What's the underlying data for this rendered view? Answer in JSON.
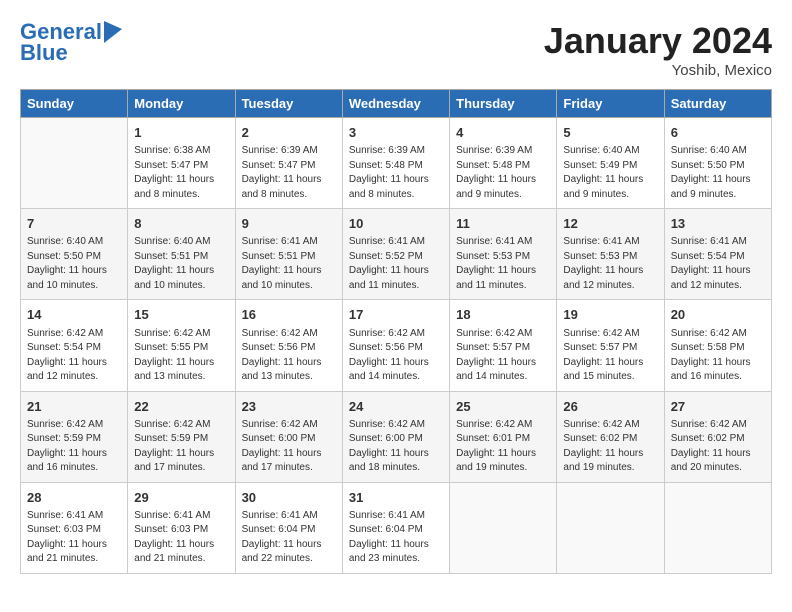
{
  "header": {
    "logo_line1": "General",
    "logo_line2": "Blue",
    "month": "January 2024",
    "location": "Yoshib, Mexico"
  },
  "weekdays": [
    "Sunday",
    "Monday",
    "Tuesday",
    "Wednesday",
    "Thursday",
    "Friday",
    "Saturday"
  ],
  "weeks": [
    [
      {
        "day": "",
        "sunrise": "",
        "sunset": "",
        "daylight": ""
      },
      {
        "day": "1",
        "sunrise": "Sunrise: 6:38 AM",
        "sunset": "Sunset: 5:47 PM",
        "daylight": "Daylight: 11 hours and 8 minutes."
      },
      {
        "day": "2",
        "sunrise": "Sunrise: 6:39 AM",
        "sunset": "Sunset: 5:47 PM",
        "daylight": "Daylight: 11 hours and 8 minutes."
      },
      {
        "day": "3",
        "sunrise": "Sunrise: 6:39 AM",
        "sunset": "Sunset: 5:48 PM",
        "daylight": "Daylight: 11 hours and 8 minutes."
      },
      {
        "day": "4",
        "sunrise": "Sunrise: 6:39 AM",
        "sunset": "Sunset: 5:48 PM",
        "daylight": "Daylight: 11 hours and 9 minutes."
      },
      {
        "day": "5",
        "sunrise": "Sunrise: 6:40 AM",
        "sunset": "Sunset: 5:49 PM",
        "daylight": "Daylight: 11 hours and 9 minutes."
      },
      {
        "day": "6",
        "sunrise": "Sunrise: 6:40 AM",
        "sunset": "Sunset: 5:50 PM",
        "daylight": "Daylight: 11 hours and 9 minutes."
      }
    ],
    [
      {
        "day": "7",
        "sunrise": "Sunrise: 6:40 AM",
        "sunset": "Sunset: 5:50 PM",
        "daylight": "Daylight: 11 hours and 10 minutes."
      },
      {
        "day": "8",
        "sunrise": "Sunrise: 6:40 AM",
        "sunset": "Sunset: 5:51 PM",
        "daylight": "Daylight: 11 hours and 10 minutes."
      },
      {
        "day": "9",
        "sunrise": "Sunrise: 6:41 AM",
        "sunset": "Sunset: 5:51 PM",
        "daylight": "Daylight: 11 hours and 10 minutes."
      },
      {
        "day": "10",
        "sunrise": "Sunrise: 6:41 AM",
        "sunset": "Sunset: 5:52 PM",
        "daylight": "Daylight: 11 hours and 11 minutes."
      },
      {
        "day": "11",
        "sunrise": "Sunrise: 6:41 AM",
        "sunset": "Sunset: 5:53 PM",
        "daylight": "Daylight: 11 hours and 11 minutes."
      },
      {
        "day": "12",
        "sunrise": "Sunrise: 6:41 AM",
        "sunset": "Sunset: 5:53 PM",
        "daylight": "Daylight: 11 hours and 12 minutes."
      },
      {
        "day": "13",
        "sunrise": "Sunrise: 6:41 AM",
        "sunset": "Sunset: 5:54 PM",
        "daylight": "Daylight: 11 hours and 12 minutes."
      }
    ],
    [
      {
        "day": "14",
        "sunrise": "Sunrise: 6:42 AM",
        "sunset": "Sunset: 5:54 PM",
        "daylight": "Daylight: 11 hours and 12 minutes."
      },
      {
        "day": "15",
        "sunrise": "Sunrise: 6:42 AM",
        "sunset": "Sunset: 5:55 PM",
        "daylight": "Daylight: 11 hours and 13 minutes."
      },
      {
        "day": "16",
        "sunrise": "Sunrise: 6:42 AM",
        "sunset": "Sunset: 5:56 PM",
        "daylight": "Daylight: 11 hours and 13 minutes."
      },
      {
        "day": "17",
        "sunrise": "Sunrise: 6:42 AM",
        "sunset": "Sunset: 5:56 PM",
        "daylight": "Daylight: 11 hours and 14 minutes."
      },
      {
        "day": "18",
        "sunrise": "Sunrise: 6:42 AM",
        "sunset": "Sunset: 5:57 PM",
        "daylight": "Daylight: 11 hours and 14 minutes."
      },
      {
        "day": "19",
        "sunrise": "Sunrise: 6:42 AM",
        "sunset": "Sunset: 5:57 PM",
        "daylight": "Daylight: 11 hours and 15 minutes."
      },
      {
        "day": "20",
        "sunrise": "Sunrise: 6:42 AM",
        "sunset": "Sunset: 5:58 PM",
        "daylight": "Daylight: 11 hours and 16 minutes."
      }
    ],
    [
      {
        "day": "21",
        "sunrise": "Sunrise: 6:42 AM",
        "sunset": "Sunset: 5:59 PM",
        "daylight": "Daylight: 11 hours and 16 minutes."
      },
      {
        "day": "22",
        "sunrise": "Sunrise: 6:42 AM",
        "sunset": "Sunset: 5:59 PM",
        "daylight": "Daylight: 11 hours and 17 minutes."
      },
      {
        "day": "23",
        "sunrise": "Sunrise: 6:42 AM",
        "sunset": "Sunset: 6:00 PM",
        "daylight": "Daylight: 11 hours and 17 minutes."
      },
      {
        "day": "24",
        "sunrise": "Sunrise: 6:42 AM",
        "sunset": "Sunset: 6:00 PM",
        "daylight": "Daylight: 11 hours and 18 minutes."
      },
      {
        "day": "25",
        "sunrise": "Sunrise: 6:42 AM",
        "sunset": "Sunset: 6:01 PM",
        "daylight": "Daylight: 11 hours and 19 minutes."
      },
      {
        "day": "26",
        "sunrise": "Sunrise: 6:42 AM",
        "sunset": "Sunset: 6:02 PM",
        "daylight": "Daylight: 11 hours and 19 minutes."
      },
      {
        "day": "27",
        "sunrise": "Sunrise: 6:42 AM",
        "sunset": "Sunset: 6:02 PM",
        "daylight": "Daylight: 11 hours and 20 minutes."
      }
    ],
    [
      {
        "day": "28",
        "sunrise": "Sunrise: 6:41 AM",
        "sunset": "Sunset: 6:03 PM",
        "daylight": "Daylight: 11 hours and 21 minutes."
      },
      {
        "day": "29",
        "sunrise": "Sunrise: 6:41 AM",
        "sunset": "Sunset: 6:03 PM",
        "daylight": "Daylight: 11 hours and 21 minutes."
      },
      {
        "day": "30",
        "sunrise": "Sunrise: 6:41 AM",
        "sunset": "Sunset: 6:04 PM",
        "daylight": "Daylight: 11 hours and 22 minutes."
      },
      {
        "day": "31",
        "sunrise": "Sunrise: 6:41 AM",
        "sunset": "Sunset: 6:04 PM",
        "daylight": "Daylight: 11 hours and 23 minutes."
      },
      {
        "day": "",
        "sunrise": "",
        "sunset": "",
        "daylight": ""
      },
      {
        "day": "",
        "sunrise": "",
        "sunset": "",
        "daylight": ""
      },
      {
        "day": "",
        "sunrise": "",
        "sunset": "",
        "daylight": ""
      }
    ]
  ]
}
